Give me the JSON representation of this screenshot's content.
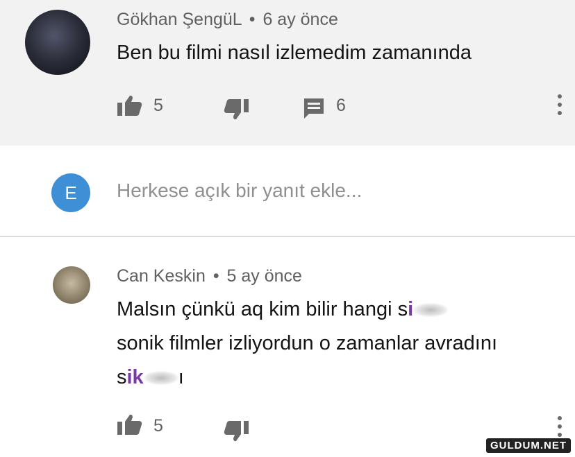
{
  "comment1": {
    "author": "Gökhan ŞengüL",
    "separator": "•",
    "time": "6 ay önce",
    "text": "Ben bu filmi nasıl izlemedim zamanında",
    "likes": "5",
    "replies": "6"
  },
  "reply_box": {
    "avatar_letter": "E",
    "placeholder": "Herkese açık bir yanıt ekle..."
  },
  "comment2": {
    "author": "Can Keskin",
    "separator": "•",
    "time": "5 ay önce",
    "line1_start": "Malsın çünkü aq kim bilir hangi s",
    "line1_censored": "i",
    "line2": "sonik filmler izliyordun o zamanlar avradını",
    "line3_start": "s",
    "line3_censored": "ik",
    "line3_end": "ı",
    "likes": "5"
  },
  "watermark": "GULDUM.NET",
  "colors": {
    "top_background": "#f2f2f2",
    "avatar_blue": "#3f8fd6",
    "icon_gray": "#6a6a6a",
    "scribble_purple": "#7a3aa6"
  }
}
